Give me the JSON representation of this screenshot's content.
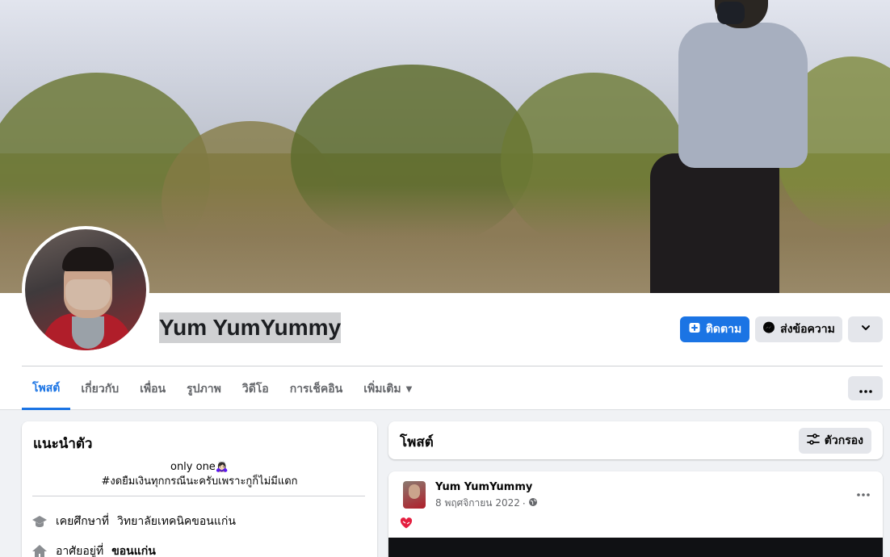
{
  "profile": {
    "name": "Yum YumYummy"
  },
  "actions": {
    "follow_label": "ติดตาม",
    "message_label": "ส่งข้อความ"
  },
  "tabs": [
    {
      "label": "โพสต์",
      "active": true
    },
    {
      "label": "เกี่ยวกับ"
    },
    {
      "label": "เพื่อน"
    },
    {
      "label": "รูปภาพ"
    },
    {
      "label": "วิดีโอ"
    },
    {
      "label": "การเช็คอิน"
    },
    {
      "label": "เพิ่มเติม"
    }
  ],
  "intro": {
    "title": "แนะนำตัว",
    "bio_line1": "only one🙇🏻‍♀️",
    "bio_line2": "#งดยืมเงินทุกกรณีนะครับเพราะกูก็ไม่มีแดก",
    "studied_prefix": "เคยศึกษาที่",
    "studied_place": "วิทยาลัยเทคนิคขอนแก่น",
    "lives_prefix": "อาศัยอยู่ที่",
    "lives_place": "ขอนแก่น"
  },
  "posts_section": {
    "title": "โพสต์",
    "filter_label": "ตัวกรอง"
  },
  "post": {
    "author": "Yum YumYummy",
    "date": "8 พฤศจิกายน 2022",
    "dot": "·",
    "content_emoji": "❤️‍🩹"
  },
  "colors": {
    "accent": "#1b74e4",
    "page_bg": "#f0f2f5",
    "button_gray": "#e4e6eb",
    "text_secondary": "#65676b"
  }
}
